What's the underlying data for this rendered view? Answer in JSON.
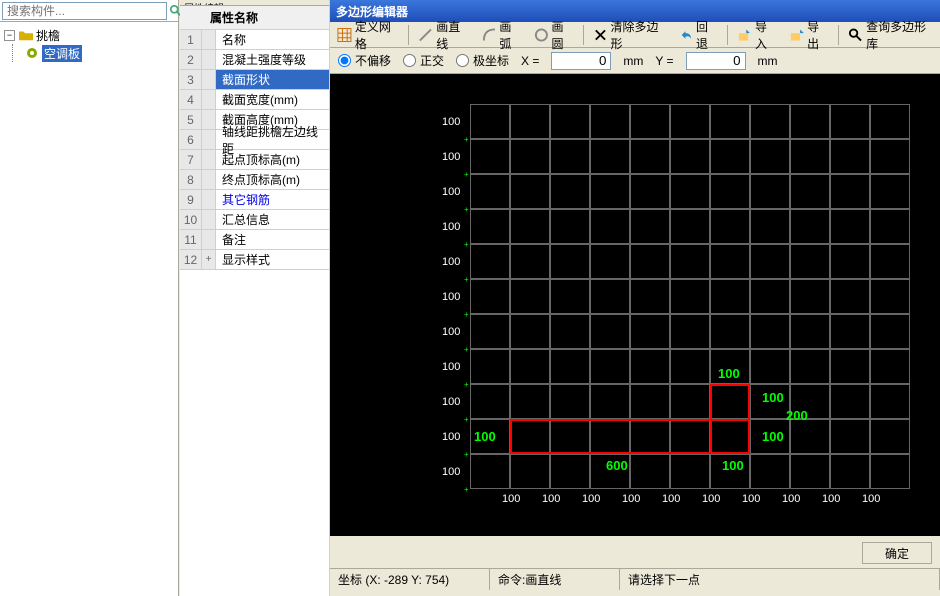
{
  "search": {
    "placeholder": "搜索构件..."
  },
  "tree": {
    "root": "挑檐",
    "child": "空调板"
  },
  "mid": {
    "tab": "属性编辑",
    "header": "属性名称",
    "rows": [
      {
        "n": "1",
        "name": "名称",
        "link": false
      },
      {
        "n": "2",
        "name": "混凝土强度等级",
        "link": false
      },
      {
        "n": "3",
        "name": "截面形状",
        "link": false,
        "selected": true
      },
      {
        "n": "4",
        "name": "截面宽度(mm)",
        "link": false
      },
      {
        "n": "5",
        "name": "截面高度(mm)",
        "link": false
      },
      {
        "n": "6",
        "name": "轴线距挑檐左边线距",
        "link": false
      },
      {
        "n": "7",
        "name": "起点顶标高(m)",
        "link": false
      },
      {
        "n": "8",
        "name": "终点顶标高(m)",
        "link": false
      },
      {
        "n": "9",
        "name": "其它钢筋",
        "link": true
      },
      {
        "n": "10",
        "name": "汇总信息",
        "link": false
      },
      {
        "n": "11",
        "name": "备注",
        "link": false
      },
      {
        "n": "12",
        "name": "显示样式",
        "link": false,
        "expand": "+"
      }
    ]
  },
  "editor": {
    "title": "多边形编辑器",
    "toolbar": {
      "define_grid": "定义网格",
      "draw_line": "画直线",
      "draw_arc": "画弧",
      "draw_circle": "画圆",
      "clear": "清除多边形",
      "undo": "回退",
      "import": "导入",
      "export": "导出",
      "query": "查询多边形库"
    },
    "radios": {
      "no_offset": "不偏移",
      "ortho": "正交",
      "polar": "极坐标"
    },
    "coords": {
      "x_label": "X =",
      "x_val": "0",
      "x_unit": "mm",
      "y_label": "Y =",
      "y_val": "0",
      "y_unit": "mm"
    },
    "grid_vals": [
      "100",
      "100",
      "100",
      "100",
      "100",
      "100",
      "100",
      "100",
      "100",
      "100",
      "100"
    ],
    "dims": {
      "top100": "100",
      "right100a": "100",
      "right200": "200",
      "right100b": "100",
      "left100": "100",
      "bottom600": "600",
      "bottom100": "100"
    },
    "btn_ok": "确定",
    "status": {
      "coord": "坐标 (X: -289 Y: 754)",
      "cmd": "命令:画直线",
      "prompt": "请选择下一点"
    }
  }
}
